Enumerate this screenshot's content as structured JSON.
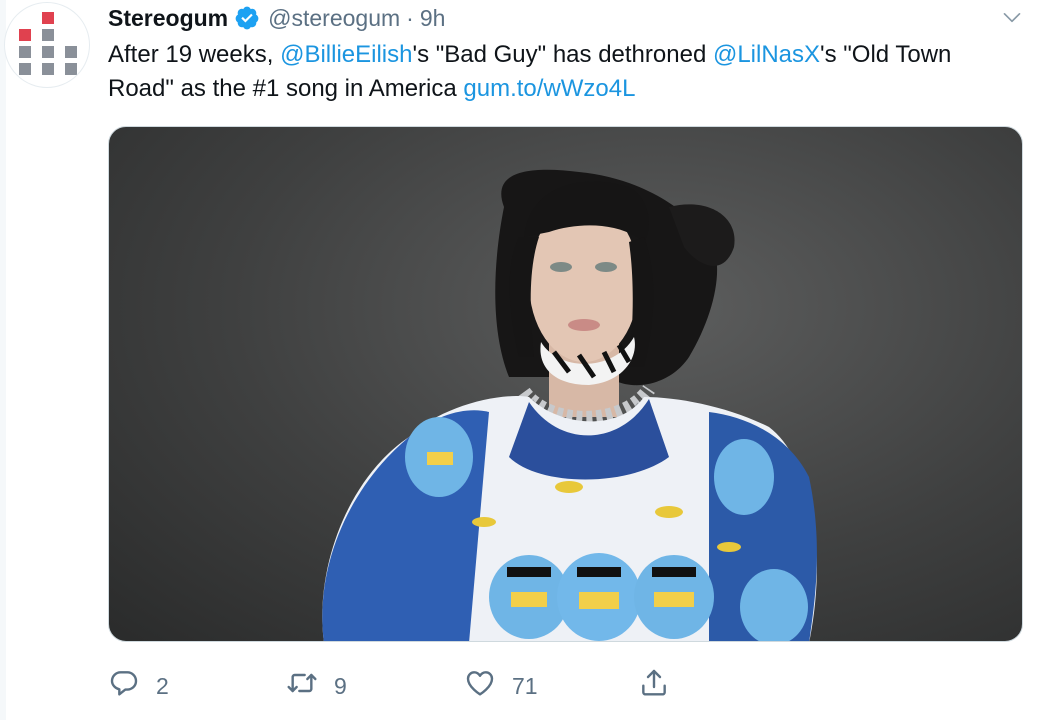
{
  "tweet": {
    "display_name": "Stereogum",
    "handle": "@stereogum",
    "separator": "·",
    "time": "9h",
    "text_parts": {
      "t1": "After 19 weeks, ",
      "m1": "@BillieEilish",
      "t2": "'s \"Bad Guy\" has dethroned ",
      "m2": "@LilNasX",
      "t3": "'s \"Old Town Road\" as the #1 song in America ",
      "link": "gum.to/wWzo4L"
    }
  },
  "actions": {
    "reply_count": "2",
    "retweet_count": "9",
    "like_count": "71"
  },
  "colors": {
    "link": "#1b95e0",
    "muted": "#5b7083",
    "verified": "#1da1f2",
    "logo_red": "#e0414f",
    "logo_gray": "#8a9099"
  },
  "icons": {
    "verified": "verified-badge-icon",
    "caret": "chevron-down-icon",
    "reply": "reply-icon",
    "retweet": "retweet-icon",
    "like": "heart-icon",
    "share": "share-icon"
  }
}
